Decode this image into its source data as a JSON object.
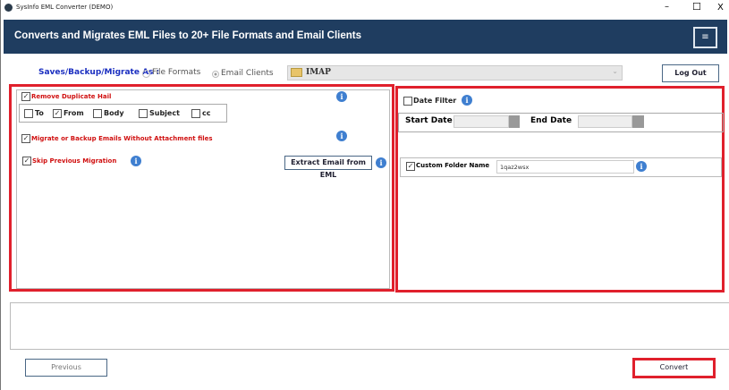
{
  "window": {
    "title": "SysInfo EML Converter (DEMO)",
    "controls": {
      "minimize": "–",
      "maximize": "☐",
      "close": "X"
    }
  },
  "header": {
    "title": "Converts and Migrates EML Files to 20+ File Formats and Email Clients",
    "menu_icon": "≡",
    "bg": "#1f3d60"
  },
  "save_as": {
    "label": "Saves/Backup/Migrate As :",
    "options": [
      {
        "label": "File Formats",
        "selected": false
      },
      {
        "label": "Email Clients",
        "selected": true
      }
    ],
    "selected_client": "IMAP",
    "logout": "Log Out"
  },
  "left": {
    "remove_duplicate": {
      "label": "Remove Duplicate Hail",
      "checked": true
    },
    "dup_fields": [
      {
        "label": "To",
        "checked": false
      },
      {
        "label": "From",
        "checked": true
      },
      {
        "label": "Body",
        "checked": false
      },
      {
        "label": "Subject",
        "checked": false
      },
      {
        "label": "cc",
        "checked": false
      }
    ],
    "migrate_without_attachments": {
      "label": "Migrate or Backup Emails Without Attachment files",
      "checked": true
    },
    "skip_previous": {
      "label": "Skip Previous Migration",
      "checked": true
    },
    "extract_button": "Extract Email from EML"
  },
  "right": {
    "date_filter": {
      "label": "Date Filter",
      "checked": false
    },
    "start_date": "Start Date",
    "end_date": "End Date",
    "custom_folder": {
      "label": "Custom Folder Name",
      "checked": true,
      "value": "1qaz2wsx"
    }
  },
  "footer": {
    "previous": "Previous",
    "convert": "Convert"
  }
}
